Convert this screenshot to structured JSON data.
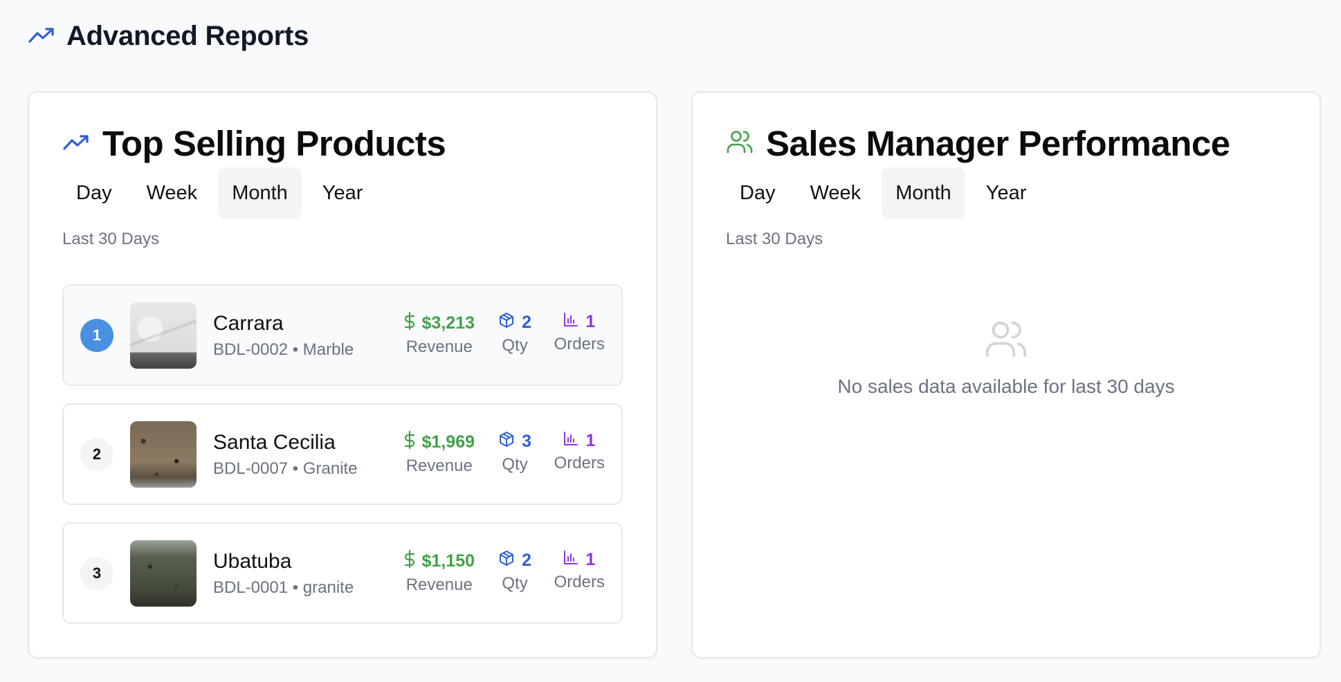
{
  "page": {
    "title": "Advanced Reports",
    "icon": "trending-up-icon"
  },
  "colors": {
    "accent_blue": "#2f5fd6",
    "accent_green": "#43a047",
    "accent_purple": "#9333ea",
    "rank_first": "#4a90e2"
  },
  "top_products": {
    "title": "Top Selling Products",
    "icon": "trending-up-icon",
    "tabs": [
      "Day",
      "Week",
      "Month",
      "Year"
    ],
    "active_tab": "Month",
    "range_label": "Last 30 Days",
    "items": [
      {
        "rank": "1",
        "name": "Carrara",
        "meta": "BDL-0002 • Marble",
        "revenue": "$3,213",
        "qty": "2",
        "orders": "1",
        "image": "marble-slab-image"
      },
      {
        "rank": "2",
        "name": "Santa Cecilia",
        "meta": "BDL-0007 • Granite",
        "revenue": "$1,969",
        "qty": "3",
        "orders": "1",
        "image": "granite-slab-image"
      },
      {
        "rank": "3",
        "name": "Ubatuba",
        "meta": "BDL-0001 • granite",
        "revenue": "$1,150",
        "qty": "2",
        "orders": "1",
        "image": "granite-slab-image"
      }
    ],
    "labels": {
      "revenue": "Revenue",
      "qty": "Qty",
      "orders": "Orders"
    }
  },
  "sales_managers": {
    "title": "Sales Manager Performance",
    "icon": "users-icon",
    "tabs": [
      "Day",
      "Week",
      "Month",
      "Year"
    ],
    "active_tab": "Month",
    "range_label": "Last 30 Days",
    "empty_message": "No sales data available for last 30 days"
  }
}
